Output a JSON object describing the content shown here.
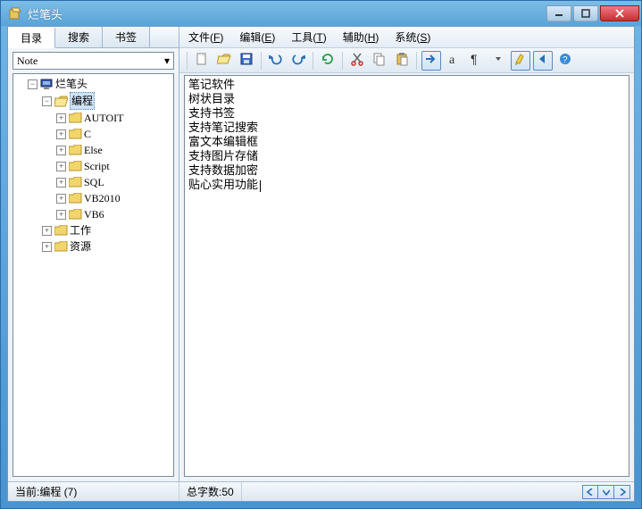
{
  "window": {
    "title": "烂笔头"
  },
  "tabs": {
    "items": [
      "目录",
      "搜索",
      "书签"
    ],
    "active": 0
  },
  "combo": {
    "value": "Note"
  },
  "tree": {
    "root": "烂笔头",
    "children": [
      {
        "label": "编程",
        "open": true,
        "children": [
          {
            "label": "AUTOIT"
          },
          {
            "label": "C"
          },
          {
            "label": "Else"
          },
          {
            "label": "Script"
          },
          {
            "label": "SQL"
          },
          {
            "label": "VB2010"
          },
          {
            "label": "VB6"
          }
        ]
      },
      {
        "label": "工作"
      },
      {
        "label": "资源"
      }
    ]
  },
  "menus": [
    {
      "label": "文件",
      "key": "F"
    },
    {
      "label": "编辑",
      "key": "E"
    },
    {
      "label": "工具",
      "key": "T"
    },
    {
      "label": "辅助",
      "key": "H"
    },
    {
      "label": "系统",
      "key": "S"
    }
  ],
  "toolbar_icons": [
    "new",
    "open",
    "save",
    "undo",
    "redo",
    "refresh",
    "cut",
    "copy",
    "paste",
    "goto",
    "font-a",
    "pilcrow",
    "dropdown",
    "highlight",
    "back",
    "help"
  ],
  "editor_lines": [
    "笔记软件",
    "树状目录",
    "支持书签",
    "支持笔记搜索",
    "富文本编辑框",
    "支持图片存储",
    "支持数据加密",
    "贴心实用功能"
  ],
  "status": {
    "left": "当前:编程 (7)",
    "right": "总字数:50"
  }
}
